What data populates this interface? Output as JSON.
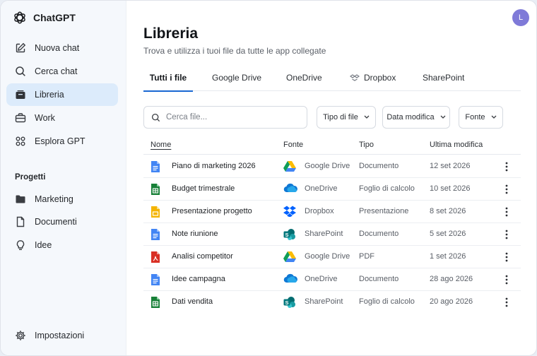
{
  "app": {
    "name": "ChatGPT",
    "user_initial": "L"
  },
  "sidebar": {
    "items": [
      {
        "label": "Nuova chat",
        "icon": "edit-icon"
      },
      {
        "label": "Cerca chat",
        "icon": "search-icon"
      },
      {
        "label": "Libreria",
        "icon": "library-icon",
        "active": true
      },
      {
        "label": "Work",
        "icon": "briefcase-icon"
      },
      {
        "label": "Esplora GPT",
        "icon": "grid-icon"
      }
    ],
    "projects_title": "Progetti",
    "projects": [
      {
        "label": "Marketing",
        "icon": "folder-icon"
      },
      {
        "label": "Documenti",
        "icon": "document-icon"
      },
      {
        "label": "Idee",
        "icon": "lightbulb-icon"
      }
    ],
    "settings_label": "Impostazioni"
  },
  "page": {
    "title": "Libreria",
    "subtitle": "Trova e utilizza i tuoi file da tutte le app collegate"
  },
  "tabs": [
    {
      "label": "Tutti i file",
      "active": true
    },
    {
      "label": "Google Drive"
    },
    {
      "label": "OneDrive"
    },
    {
      "label": "Dropbox"
    },
    {
      "label": "SharePoint"
    }
  ],
  "search": {
    "placeholder": "Cerca file..."
  },
  "filters": {
    "type": "Tipo di file",
    "modified": "Data modifica",
    "source": "Fonte"
  },
  "table": {
    "headers": {
      "name": "Nome",
      "source": "Fonte",
      "type": "Tipo",
      "modified": "Ultima modifica"
    },
    "rows": [
      {
        "name": "Piano di marketing 2026",
        "source": "Google Drive",
        "type": "Documento",
        "date": "12 set 2026"
      },
      {
        "name": "Budget trimestrale",
        "source": "OneDrive",
        "type": "Foglio di calcolo",
        "date": "10 set 2026"
      },
      {
        "name": "Presentazione progetto",
        "source": "Dropbox",
        "type": "Presentazione",
        "date": "8 set 2026"
      },
      {
        "name": "Note riunione",
        "source": "SharePoint",
        "type": "Documento",
        "date": "5 set 2026"
      },
      {
        "name": "Analisi competitor",
        "source": "Google Drive",
        "type": "PDF",
        "date": "1 set 2026"
      },
      {
        "name": "Idee campagna",
        "source": "OneDrive",
        "type": "Documento",
        "date": "28 ago 2026"
      },
      {
        "name": "Dati vendita",
        "source": "SharePoint",
        "type": "Foglio di calcolo",
        "date": "20 ago 2026"
      }
    ]
  },
  "colors": {
    "accent": "#1967d2",
    "active_nav": "#dcebfb",
    "doc_blue": "#4285f4",
    "sheet_green": "#188038",
    "slides_yellow": "#f4b400",
    "pdf_red": "#d93025",
    "sharepoint_teal": "#03787c",
    "onedrive_blue": "#0f78d4",
    "dropbox_blue": "#0061fe",
    "avatar": "#7f7ad8"
  }
}
